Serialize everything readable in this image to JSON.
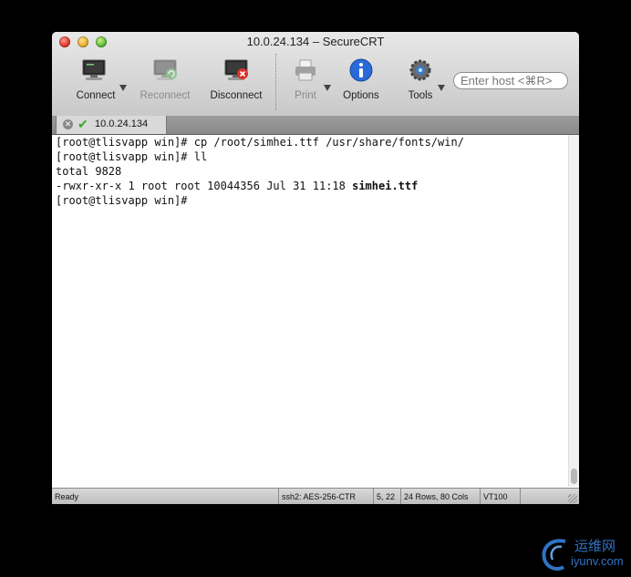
{
  "window": {
    "title": "10.0.24.134 – SecureCRT"
  },
  "toolbar": {
    "connect_label": "Connect",
    "reconnect_label": "Reconnect",
    "disconnect_label": "Disconnect",
    "print_label": "Print",
    "options_label": "Options",
    "tools_label": "Tools",
    "host_placeholder": "Enter host <⌘R>"
  },
  "tabs": [
    {
      "label": "10.0.24.134"
    }
  ],
  "terminal": {
    "lines": [
      "[root@tlisvapp win]# cp /root/simhei.ttf /usr/share/fonts/win/",
      "[root@tlisvapp win]# ll",
      "total 9828"
    ],
    "file_line_prefix": "-rwxr-xr-x 1 root root 10044356 Jul 31 11:18 ",
    "file_line_name": "simhei.ttf",
    "prompt_line": "[root@tlisvapp win]#"
  },
  "statusbar": {
    "status": "Ready",
    "cipher": "ssh2: AES-256-CTR",
    "cursor": "5, 22",
    "size": "24 Rows, 80 Cols",
    "emulation": "VT100"
  },
  "watermark": {
    "cn": "运维网",
    "en": "iyunv.com"
  }
}
